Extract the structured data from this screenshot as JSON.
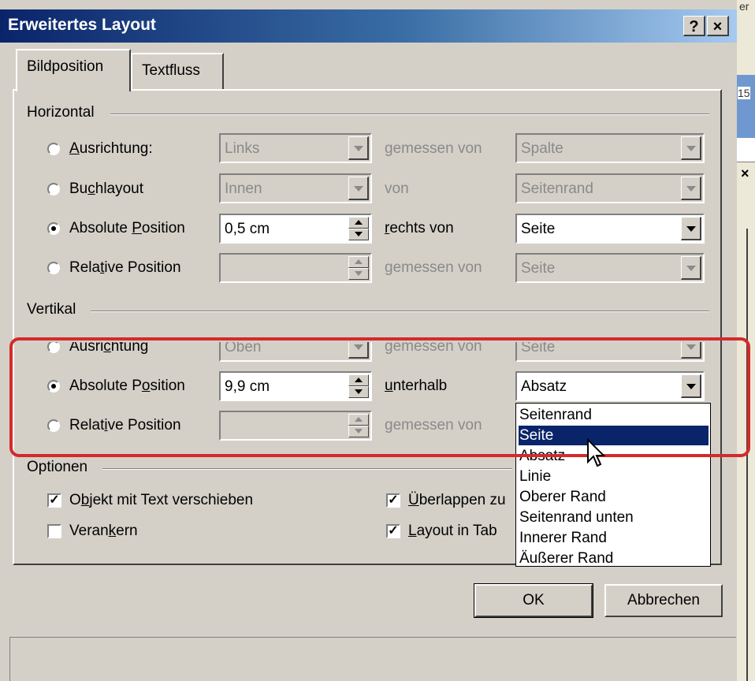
{
  "dialog": {
    "title": "Erweitertes Layout",
    "help_label": "?",
    "close_label": "×"
  },
  "background": {
    "text_top": "er",
    "text_num": "15"
  },
  "tabs": [
    {
      "label": "Bildposition",
      "active": true
    },
    {
      "label": "Textfluss",
      "active": false
    }
  ],
  "horizontal": {
    "group_label": "Horizontal",
    "rows": [
      {
        "radio_label": "Ausrichtung:",
        "checked": false,
        "value": "Links",
        "relation": "gemessen von",
        "target": "Spalte",
        "enabled": false
      },
      {
        "radio_label": "Buchlayout",
        "checked": false,
        "value": "Innen",
        "relation": "von",
        "target": "Seitenrand",
        "enabled": false
      },
      {
        "radio_label": "Absolute Position",
        "checked": true,
        "value": "0,5 cm",
        "relation": "rechts von",
        "target": "Seite",
        "enabled": true
      },
      {
        "radio_label": "Relative Position",
        "checked": false,
        "value": "",
        "relation": "gemessen von",
        "target": "Seite",
        "enabled": false
      }
    ]
  },
  "vertical": {
    "group_label": "Vertikal",
    "rows": [
      {
        "radio_label": "Ausrichtung",
        "checked": false,
        "value": "Oben",
        "relation": "gemessen von",
        "target": "Seite",
        "enabled": false
      },
      {
        "radio_label": "Absolute Position",
        "checked": true,
        "value": "9,9 cm",
        "relation": "unterhalb",
        "target": "Absatz",
        "enabled": true
      },
      {
        "radio_label": "Relative Position",
        "checked": false,
        "value": "",
        "relation": "gemessen von",
        "target": "",
        "enabled": false
      }
    ]
  },
  "dropdown_options": [
    "Seitenrand",
    "Seite",
    "Absatz",
    "Linie",
    "Oberer Rand",
    "Seitenrand unten",
    "Innerer Rand",
    "Äußerer Rand"
  ],
  "dropdown_selected_index": 1,
  "options": {
    "group_label": "Optionen",
    "move_with_text": {
      "label": "Objekt mit Text verschieben",
      "checked": true
    },
    "anchor": {
      "label": "Verankern",
      "checked": false
    },
    "overlap": {
      "label": "Überlappen zu",
      "checked": true
    },
    "layout_in_table": {
      "label": "Layout in Tab",
      "checked": true
    }
  },
  "buttons": {
    "ok": "OK",
    "cancel": "Abbrechen"
  },
  "colors": {
    "titlebar": "#0a246a",
    "highlight": "#d42a2a",
    "selection": "#0a246a"
  }
}
